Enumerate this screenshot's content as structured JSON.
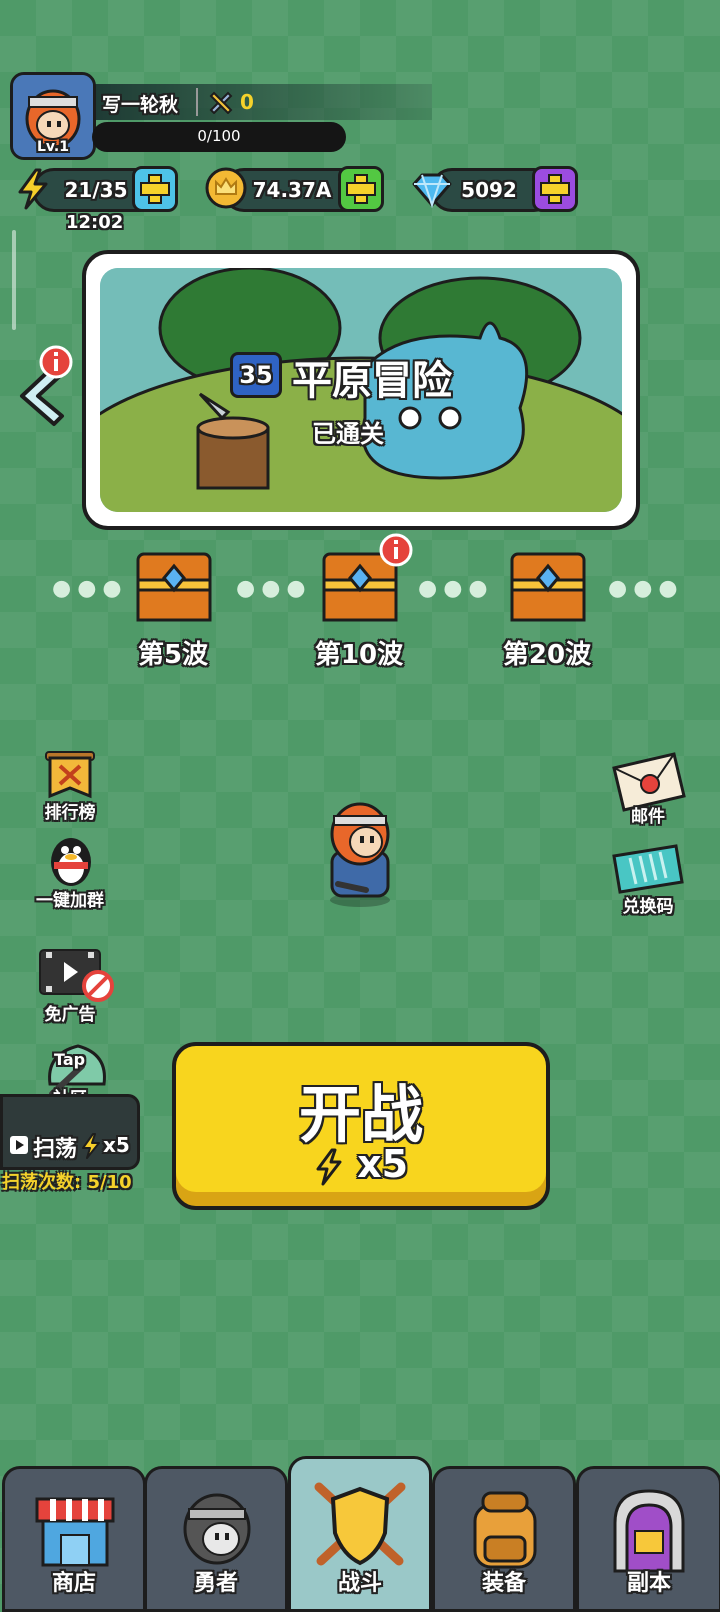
{
  "player": {
    "level": "Lv.1",
    "name": "写一轮秋",
    "trophies": "0",
    "exp": "0/100"
  },
  "resources": {
    "energy": "21/35",
    "energy_timer": "12:02",
    "gold": "74.37A",
    "gems": "5092"
  },
  "stage": {
    "number": "35",
    "title": "平原冒险",
    "status": "已通关"
  },
  "rewards": [
    {
      "label": "第5波"
    },
    {
      "label": "第10波"
    },
    {
      "label": "第20波"
    }
  ],
  "left_menu": {
    "rank": "排行榜",
    "qq_group": "一键加群",
    "no_ads": "免广告",
    "tap_logo": "Tap",
    "community": "社区",
    "sweep": "扫荡",
    "sweep_cost": "x5",
    "sweep_count_label": "扫荡次数:",
    "sweep_count": "5/10"
  },
  "right_menu": {
    "mail": "邮件",
    "redeem": "兑换码"
  },
  "start": {
    "label": "开战",
    "cost": "x5"
  },
  "nav": {
    "tabs": [
      {
        "label": "商店"
      },
      {
        "label": "勇者"
      },
      {
        "label": "战斗"
      },
      {
        "label": "装备"
      },
      {
        "label": "副本"
      }
    ],
    "active_index": 2
  }
}
